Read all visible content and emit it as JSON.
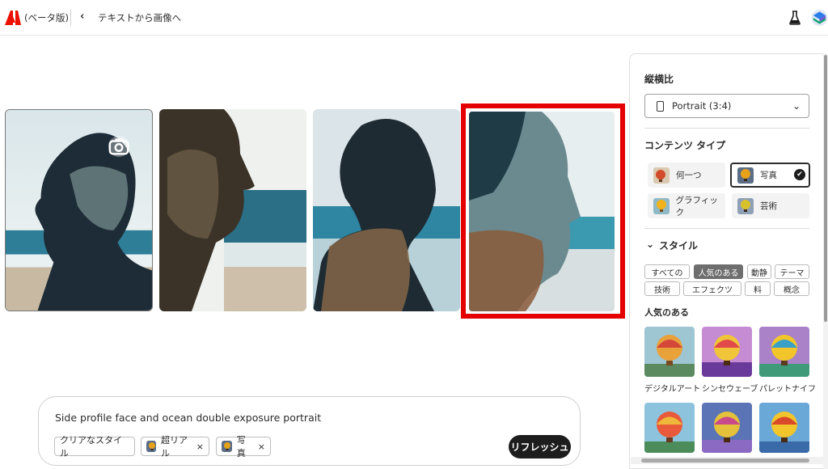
{
  "header": {
    "beta_label": "(ベータ版)",
    "back_glyph": "‹",
    "title": "テキストから画像へ"
  },
  "prompt": {
    "text": "Side profile face and ocean double exposure portrait",
    "chips": [
      {
        "label": "クリアなスタイル"
      },
      {
        "label": "超リアル",
        "remove": "×"
      },
      {
        "label": "写真",
        "remove": "×"
      }
    ],
    "refresh_label": "リフレッシュ"
  },
  "panel": {
    "aspect_heading": "縦横比",
    "aspect_value": "Portrait (3:4)",
    "content_heading": "コンテンツ タイプ",
    "content_types": [
      {
        "label": "何一つ"
      },
      {
        "label": "写真",
        "selected": true
      },
      {
        "label": "グラフィック"
      },
      {
        "label": "芸術"
      }
    ],
    "style_heading": "スタイル",
    "style_tags": [
      "すべての",
      "人気のある",
      "動静",
      "テーマ",
      "技術",
      "エフェクツ",
      "料",
      "概念"
    ],
    "popular_heading": "人気のある",
    "popular_items": [
      "デジタルアート",
      "シンセウェーブ",
      "パレットナイフ"
    ]
  },
  "colors": {
    "selection_outline": "#e40000",
    "adobe_red": "#eb1000",
    "refresh_bg": "#1d1d1d"
  }
}
